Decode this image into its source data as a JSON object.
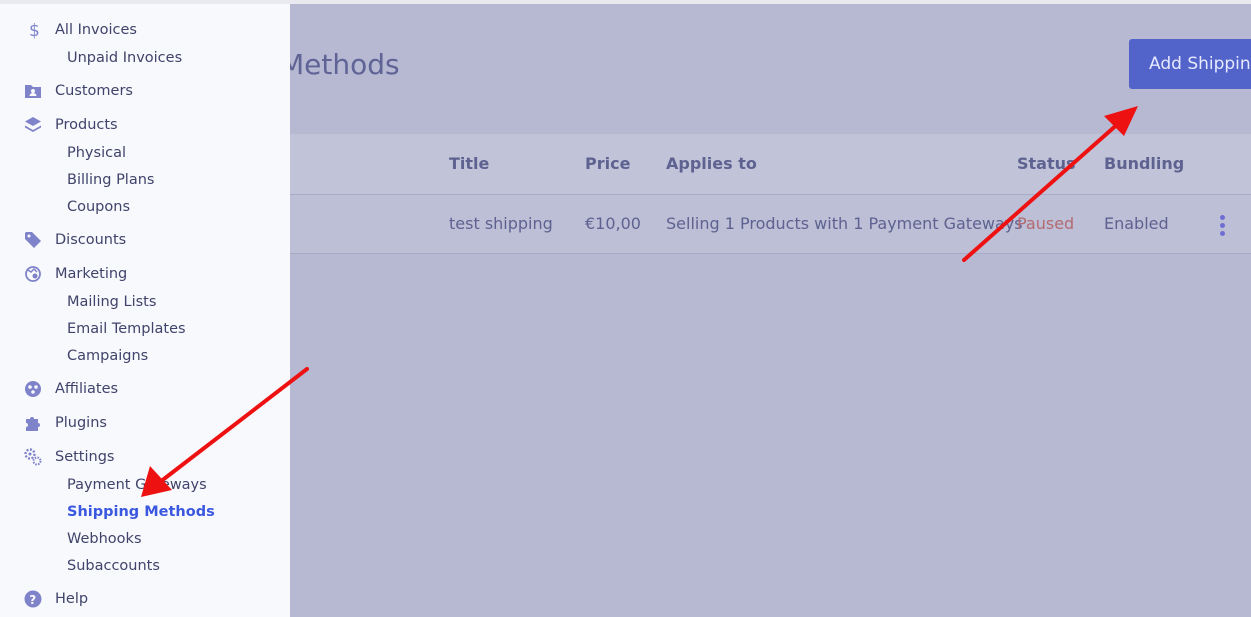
{
  "page": {
    "title_partial": "ping Methods",
    "add_button_label": "Add Shipping"
  },
  "table": {
    "headers": [
      "Title",
      "Price",
      "Applies to",
      "Status",
      "Bundling"
    ],
    "rows": [
      {
        "title": "test shipping",
        "price": "€10,00",
        "applies_to": "Selling 1 Products with 1 Payment Gateways",
        "status": "Paused",
        "bundling": "Enabled"
      }
    ]
  },
  "sidebar": {
    "items": [
      {
        "label": "All Invoices",
        "icon": "dollar-icon"
      },
      {
        "label": "Customers",
        "icon": "folder-user-icon"
      },
      {
        "label": "Products",
        "icon": "layers-icon"
      },
      {
        "label": "Discounts",
        "icon": "tag-icon"
      },
      {
        "label": "Marketing",
        "icon": "marketing-icon"
      },
      {
        "label": "Affiliates",
        "icon": "affiliates-icon"
      },
      {
        "label": "Plugins",
        "icon": "puzzle-icon"
      },
      {
        "label": "Settings",
        "icon": "gears-icon"
      },
      {
        "label": "Help",
        "icon": "help-icon"
      }
    ],
    "subitems": {
      "invoices": [
        "Unpaid Invoices"
      ],
      "products": [
        "Physical",
        "Billing Plans",
        "Coupons"
      ],
      "marketing": [
        "Mailing Lists",
        "Email Templates",
        "Campaigns"
      ],
      "settings": [
        "Payment Gateways",
        "Shipping Methods",
        "Webhooks",
        "Subaccounts"
      ]
    },
    "active_subitem": "Shipping Methods"
  },
  "colors": {
    "accent": "#3b58e0",
    "button": "#5263c9",
    "annotation_arrow": "#ee1111",
    "status_paused": "#b36a71"
  }
}
